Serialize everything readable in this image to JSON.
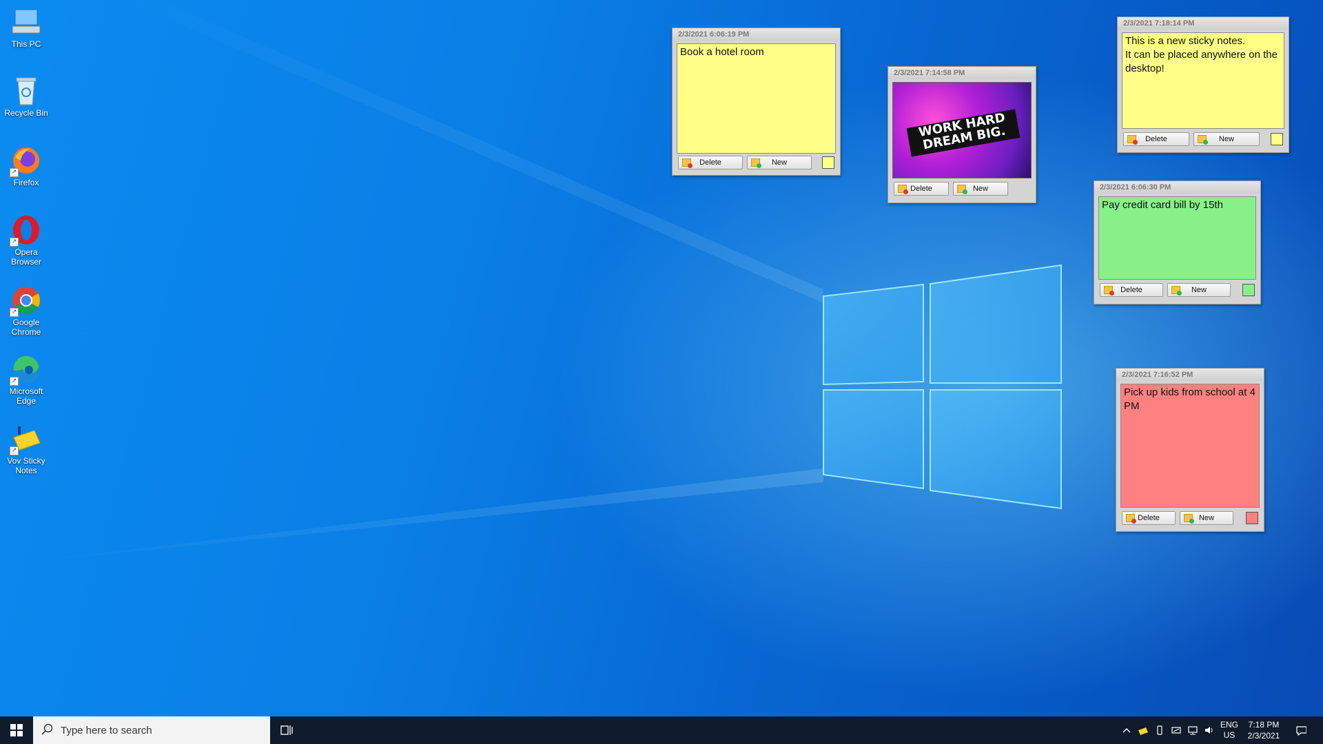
{
  "desktop_icons": [
    {
      "label": "This PC",
      "icon": "this-pc-icon"
    },
    {
      "label": "Recycle Bin",
      "icon": "recycle-bin-icon"
    },
    {
      "label": "Firefox",
      "icon": "firefox-icon"
    },
    {
      "label": "Opera Browser",
      "icon": "opera-icon"
    },
    {
      "label": "Google Chrome",
      "icon": "chrome-icon"
    },
    {
      "label": "Microsoft Edge",
      "icon": "edge-icon"
    },
    {
      "label": "Vov Sticky Notes",
      "icon": "vov-sticky-notes-icon"
    }
  ],
  "notes": [
    {
      "timestamp": "2/3/2021 6:06:19 PM",
      "text": "Book a hotel room",
      "color": "#ffff88",
      "delete_label": "Delete",
      "new_label": "New"
    },
    {
      "timestamp": "2/3/2021 7:14:58 PM",
      "image_text": "WORK HARD DREAM BIG.",
      "delete_label": "Delete",
      "new_label": "New"
    },
    {
      "timestamp": "2/3/2021 7:18:14 PM",
      "text": "This is a new sticky notes.\nIt can be placed anywhere on the desktop!",
      "color": "#ffff88",
      "delete_label": "Delete",
      "new_label": "New"
    },
    {
      "timestamp": "2/3/2021 6:06:30 PM",
      "text": "Pay credit card bill by 15th",
      "color": "#88f088",
      "delete_label": "Delete",
      "new_label": "New"
    },
    {
      "timestamp": "2/3/2021 7:16:52 PM",
      "text": "Pick up kids from school at 4 PM",
      "color": "#ff8080",
      "delete_label": "Delete",
      "new_label": "New"
    }
  ],
  "taskbar": {
    "search_placeholder": "Type here to search",
    "language": "ENG",
    "region": "US",
    "time": "7:18 PM",
    "date": "2/3/2021"
  }
}
